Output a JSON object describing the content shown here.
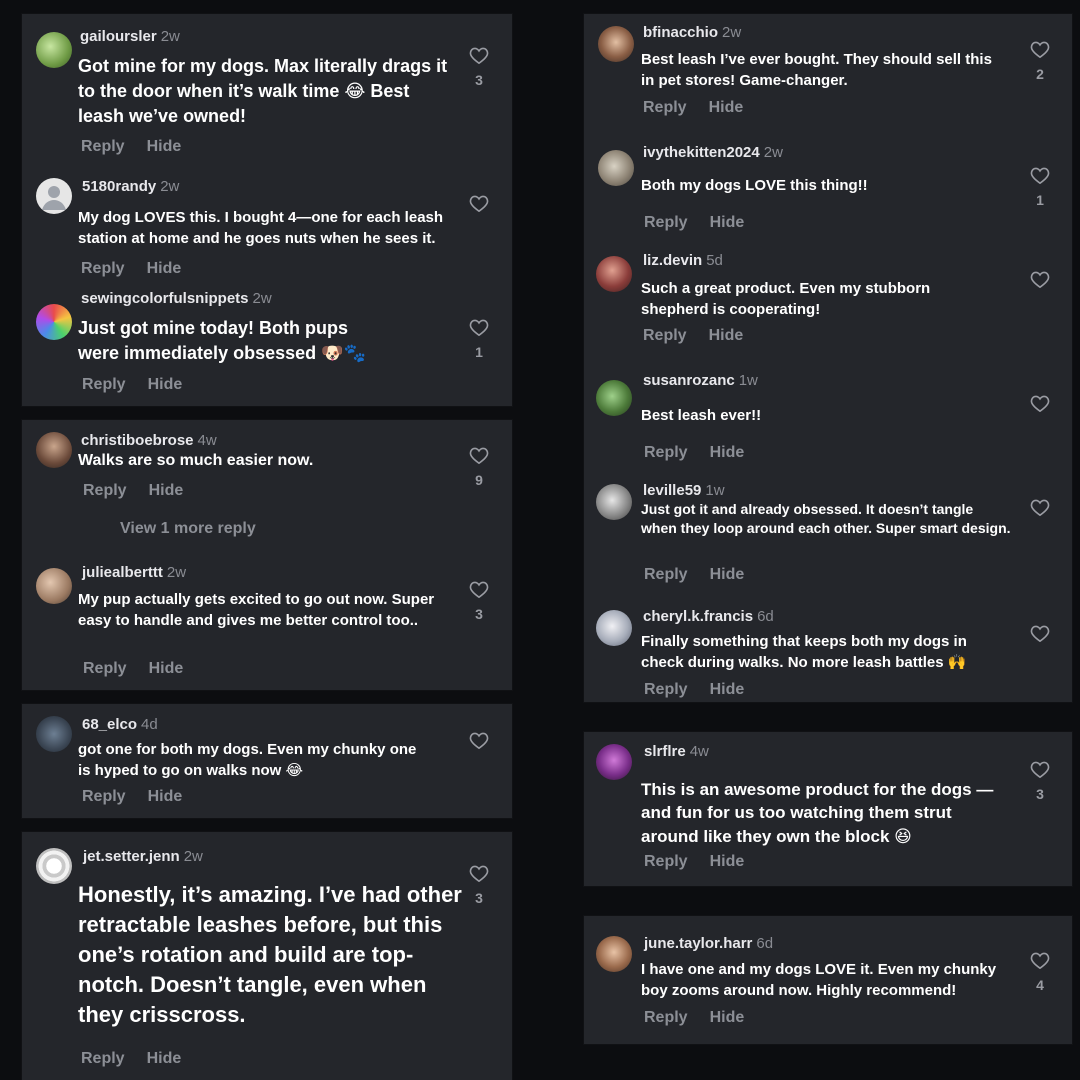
{
  "actions": {
    "reply": "Reply",
    "hide": "Hide"
  },
  "left_column": [
    {
      "username": "gailoursler",
      "time": "2w",
      "text": "Got mine for my dogs. Max literally drags it to the door when it’s walk time 😂 Best leash we’ve owned!",
      "likes": "3"
    },
    {
      "username": "5180randy",
      "time": "2w",
      "text": "My dog LOVES this. I bought 4—one for each leash station at home and he goes nuts when he sees it.",
      "likes": ""
    },
    {
      "username": "sewingcolorfulsnippets",
      "time": "2w",
      "text": "Just got mine today! Both pups were immediately obsessed 🐶🐾",
      "likes": "1"
    },
    {
      "username": "christiboebrose",
      "time": "4w",
      "text": "Walks are so much easier now.",
      "likes": "9",
      "view_more": "View 1 more reply"
    },
    {
      "username": "juliealberttt",
      "time": "2w",
      "text": "My pup actually gets excited to go out now. Super easy to handle and gives me better control too..",
      "likes": "3"
    },
    {
      "username": "68_elco",
      "time": "4d",
      "text": "got one for both my dogs. Even my chunky one is hyped to go on walks now 😂",
      "likes": ""
    },
    {
      "username": "jet.setter.jenn",
      "time": "2w",
      "text": "Honestly, it’s amazing. I’ve had other retractable leashes before, but this one’s rotation and build are top-notch. Doesn’t tangle, even when they crisscross.",
      "likes": "3"
    }
  ],
  "right_column": [
    {
      "username": "bfinacchio",
      "time": "2w",
      "text": "Best leash I’ve ever bought. They should sell this in pet stores! Game-changer.",
      "likes": "2"
    },
    {
      "username": "ivythekitten2024",
      "time": "2w",
      "text": "Both my dogs LOVE this thing!!",
      "likes": "1"
    },
    {
      "username": "liz.devin",
      "time": "5d",
      "text": "Such a great product. Even my stubborn shepherd is cooperating!",
      "likes": ""
    },
    {
      "username": "susanrozanc",
      "time": "1w",
      "text": "Best leash ever!!",
      "likes": ""
    },
    {
      "username": "leville59",
      "time": "1w",
      "text": "Just got it and already obsessed. It doesn’t tangle when they loop around each other. Super smart design.",
      "likes": ""
    },
    {
      "username": "cheryl.k.francis",
      "time": "6d",
      "text": "Finally something that keeps both my dogs in check during walks. No more leash battles 🙌",
      "likes": ""
    },
    {
      "username": "slrflre",
      "time": "4w",
      "text": "This is an awesome product for the dogs — and fun for us too watching them strut around like they own the block 😆",
      "likes": "3"
    },
    {
      "username": "june.taylor.harr",
      "time": "6d",
      "text": "I have one and my dogs LOVE it. Even my chunky boy zooms around now. Highly recommend!",
      "likes": "4"
    }
  ],
  "colors": {
    "background": "#0c0d10",
    "card": "#24262b",
    "text": "#ffffff",
    "muted": "#8c8f96"
  }
}
